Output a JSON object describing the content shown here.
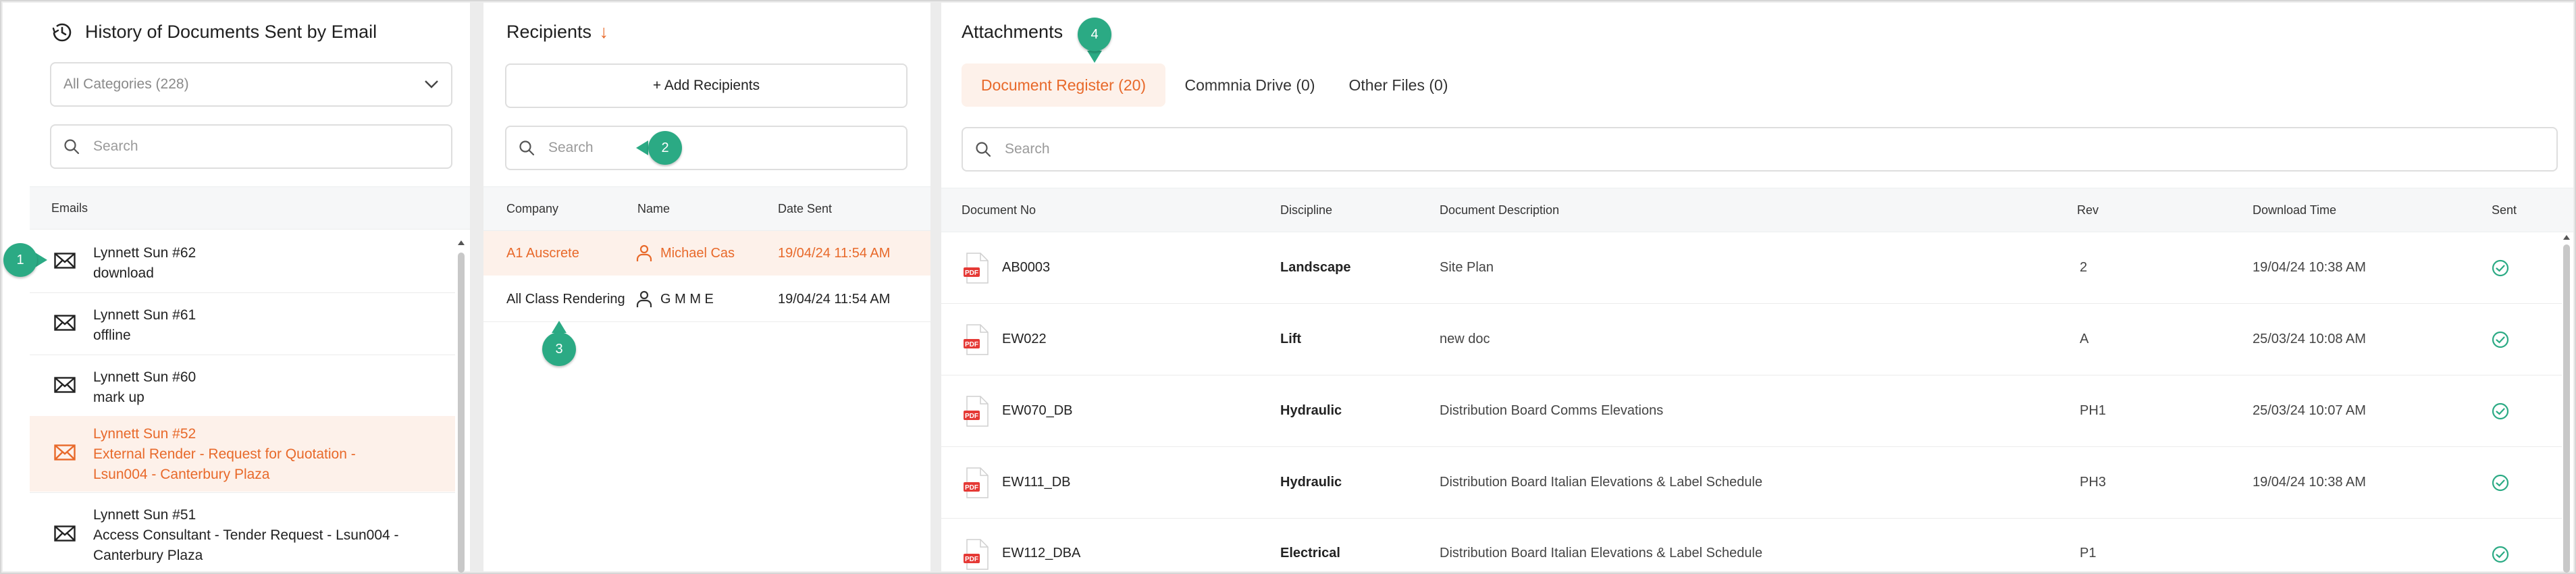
{
  "history": {
    "title": "History of Documents Sent by Email",
    "category_select": "All Categories (228)",
    "search_placeholder": "Search",
    "column_header": "Emails",
    "items": [
      {
        "title": "Lynnett Sun #62",
        "lines": [
          "download"
        ],
        "active": false
      },
      {
        "title": "Lynnett Sun #61",
        "lines": [
          "offline"
        ],
        "active": false
      },
      {
        "title": "Lynnett Sun #60",
        "lines": [
          "mark up"
        ],
        "active": false
      },
      {
        "title": "Lynnett Sun #52",
        "lines": [
          "External Render - Request for Quotation -",
          "Lsun004 - Canterbury Plaza"
        ],
        "active": true
      },
      {
        "title": "Lynnett Sun #51",
        "lines": [
          "Access Consultant - Tender Request - Lsun004 -",
          "Canterbury Plaza"
        ],
        "active": false
      }
    ]
  },
  "recipients": {
    "title": "Recipients",
    "sort_indicator": "↓",
    "add_button": "+ Add Recipients",
    "search_placeholder": "Search",
    "columns": {
      "company": "Company",
      "name": "Name",
      "date": "Date Sent"
    },
    "rows": [
      {
        "company": "A1 Auscrete",
        "name": "Michael Cas",
        "date": "19/04/24 11:54 AM",
        "active": true
      },
      {
        "company": "All Class Rendering",
        "name": "G M M E",
        "date": "19/04/24 11:54 AM",
        "active": false
      }
    ]
  },
  "attachments": {
    "title": "Attachments",
    "tabs": [
      {
        "label": "Document Register (20)",
        "active": true
      },
      {
        "label": "Commnia Drive (0)",
        "active": false
      },
      {
        "label": "Other Files (0)",
        "active": false
      }
    ],
    "search_placeholder": "Search",
    "columns": {
      "doc_no": "Document No",
      "discipline": "Discipline",
      "description": "Document Description",
      "rev": "Rev",
      "download": "Download Time",
      "sent": "Sent"
    },
    "file_badge": "PDF",
    "rows": [
      {
        "doc_no": "AB0003",
        "discipline": "Landscape",
        "description": "Site Plan",
        "rev": "2",
        "download": "19/04/24 10:38 AM"
      },
      {
        "doc_no": "EW022",
        "discipline": "Lift",
        "description": "new doc",
        "rev": "A",
        "download": "25/03/24 10:08 AM"
      },
      {
        "doc_no": "EW070_DB",
        "discipline": "Hydraulic",
        "description": "Distribution Board Comms Elevations",
        "rev": "PH1",
        "download": "25/03/24 10:07 AM"
      },
      {
        "doc_no": "EW111_DB",
        "discipline": "Hydraulic",
        "description": "Distribution Board Italian Elevations & Label Schedule",
        "rev": "PH3",
        "download": "19/04/24 10:38 AM"
      },
      {
        "doc_no": "EW112_DBA",
        "discipline": "Electrical",
        "description": "Distribution Board Italian Elevations & Label Schedule",
        "rev": "P1",
        "download": ""
      }
    ]
  },
  "markers": [
    "1",
    "2",
    "3",
    "4"
  ],
  "colors": {
    "accent": "#e8692a",
    "accent_bg": "#fdf1ea",
    "marker": "#2baa84",
    "check": "#2baa84",
    "pdf": "#e53935"
  }
}
